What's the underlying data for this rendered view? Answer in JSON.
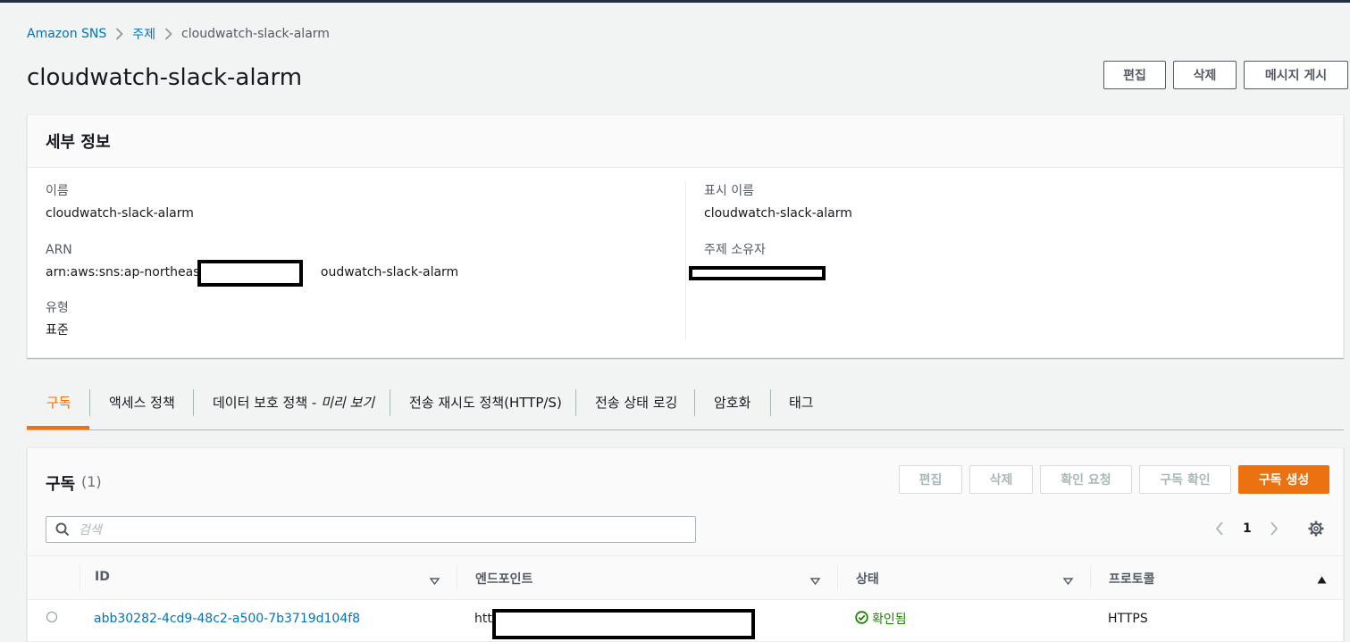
{
  "breadcrumb": {
    "root": "Amazon SNS",
    "section": "주제",
    "current": "cloudwatch-slack-alarm"
  },
  "page": {
    "title": "cloudwatch-slack-alarm",
    "edit_label": "편집",
    "delete_label": "삭제",
    "publish_label": "메시지 게시"
  },
  "details": {
    "title": "세부 정보",
    "name_label": "이름",
    "name_value": "cloudwatch-slack-alarm",
    "arn_label": "ARN",
    "arn_prefix": "arn:aws:sns:ap-northeast-2",
    "arn_suffix": "oudwatch-slack-alarm",
    "type_label": "유형",
    "type_value": "표준",
    "display_name_label": "표시 이름",
    "display_name_value": "cloudwatch-slack-alarm",
    "owner_label": "주제 소유자"
  },
  "tabs": [
    {
      "label": "구독"
    },
    {
      "label": "액세스 정책"
    },
    {
      "label": "데이터 보호 정책 - ",
      "italic": "미리 보기"
    },
    {
      "label": "전송 재시도 정책(HTTP/S)"
    },
    {
      "label": "전송 상태 로깅"
    },
    {
      "label": "암호화"
    },
    {
      "label": "태그"
    }
  ],
  "subscriptions": {
    "title": "구독",
    "count": "(1)",
    "edit_label": "편집",
    "delete_label": "삭제",
    "request_confirm_label": "확인 요청",
    "confirm_label": "구독 확인",
    "create_label": "구독 생성",
    "search_placeholder": "검색",
    "page_number": "1",
    "columns": {
      "id": "ID",
      "endpoint": "엔드포인트",
      "status": "상태",
      "protocol": "프로토콜"
    },
    "rows": [
      {
        "id": "abb30282-4cd9-48c2-a500-7b3719d104f8",
        "endpoint_prefix": "htt",
        "status": "확인됨",
        "protocol": "HTTPS"
      }
    ]
  },
  "colors": {
    "accent": "#ec7211",
    "link": "#0073bb",
    "success": "#1d8102"
  }
}
